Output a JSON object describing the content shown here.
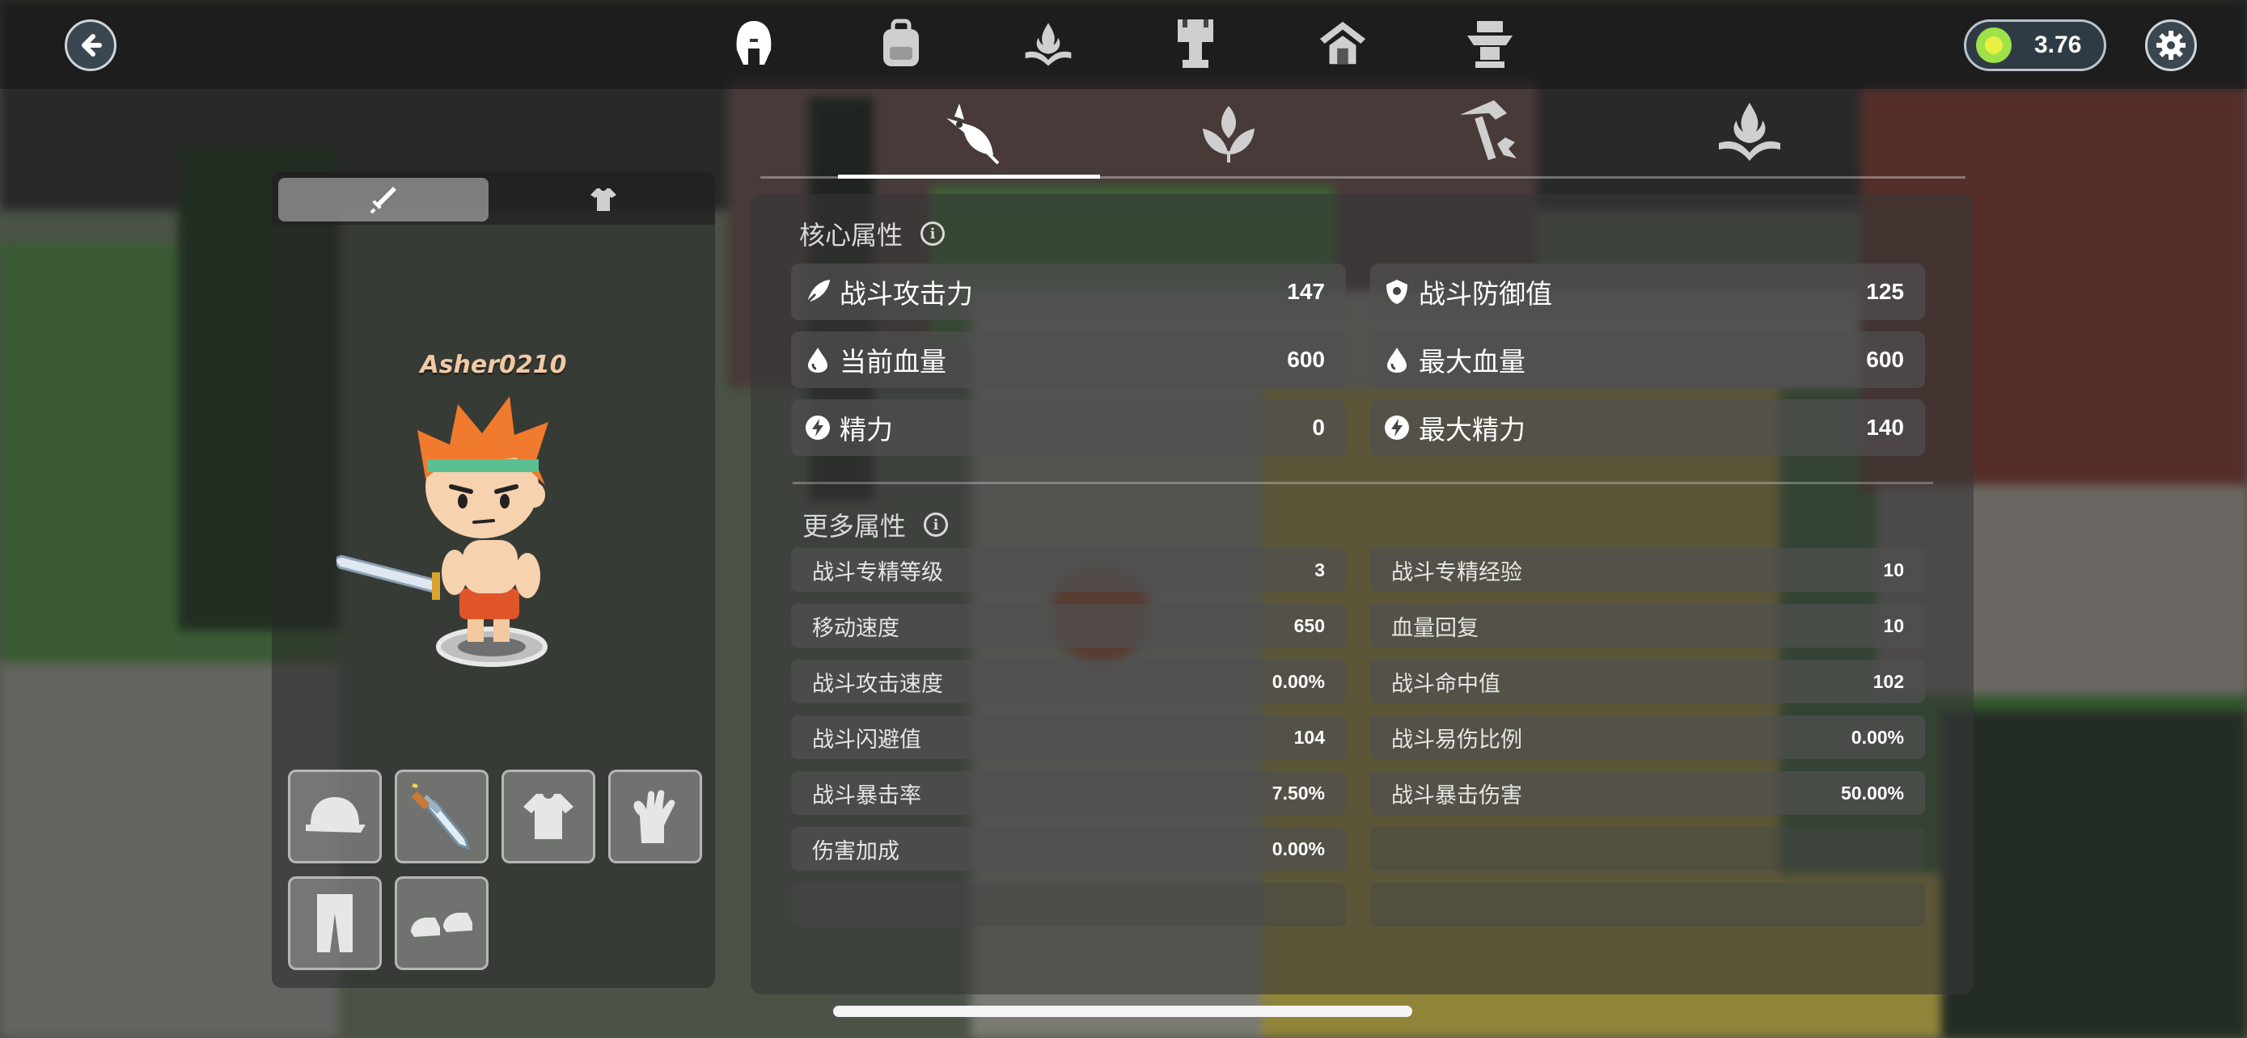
{
  "topbar": {
    "icons": [
      "helmet-icon",
      "backpack-icon",
      "flame-book-icon",
      "banner-icon",
      "emblem-icon",
      "totem-icon"
    ],
    "currency_value": "3.76"
  },
  "subtabs": [
    "fish-icon",
    "leaf-icon",
    "hammer-icon",
    "flame-icon"
  ],
  "character": {
    "name": "Asher0210",
    "tabs": [
      "sword-icon",
      "shirt-icon"
    ]
  },
  "core_attributes": {
    "title": "核心属性",
    "items": [
      {
        "label": "战斗攻击力",
        "value": "147",
        "icon": "feather-icon"
      },
      {
        "label": "战斗防御值",
        "value": "125",
        "icon": "shield-icon"
      },
      {
        "label": "当前血量",
        "value": "600",
        "icon": "blood-drop-icon"
      },
      {
        "label": "最大血量",
        "value": "600",
        "icon": "blood-drop-icon"
      },
      {
        "label": "精力",
        "value": "0",
        "icon": "lightning-icon"
      },
      {
        "label": "最大精力",
        "value": "140",
        "icon": "lightning-icon"
      }
    ]
  },
  "more_attributes": {
    "title": "更多属性",
    "items": [
      {
        "label": "战斗专精等级",
        "value": "3"
      },
      {
        "label": "战斗专精经验",
        "value": "10"
      },
      {
        "label": "移动速度",
        "value": "650"
      },
      {
        "label": "血量回复",
        "value": "10"
      },
      {
        "label": "战斗攻击速度",
        "value": "0.00%"
      },
      {
        "label": "战斗命中值",
        "value": "102"
      },
      {
        "label": "战斗闪避值",
        "value": "104"
      },
      {
        "label": "战斗易伤比例",
        "value": "0.00%"
      },
      {
        "label": "战斗暴击率",
        "value": "7.50%"
      },
      {
        "label": "战斗暴击伤害",
        "value": "50.00%"
      },
      {
        "label": "伤害加成",
        "value": "0.00%"
      }
    ]
  },
  "equipment_slots": [
    "cap-icon",
    "sword-icon",
    "shirt-icon",
    "glove-icon",
    "pants-icon",
    "shoes-icon"
  ]
}
